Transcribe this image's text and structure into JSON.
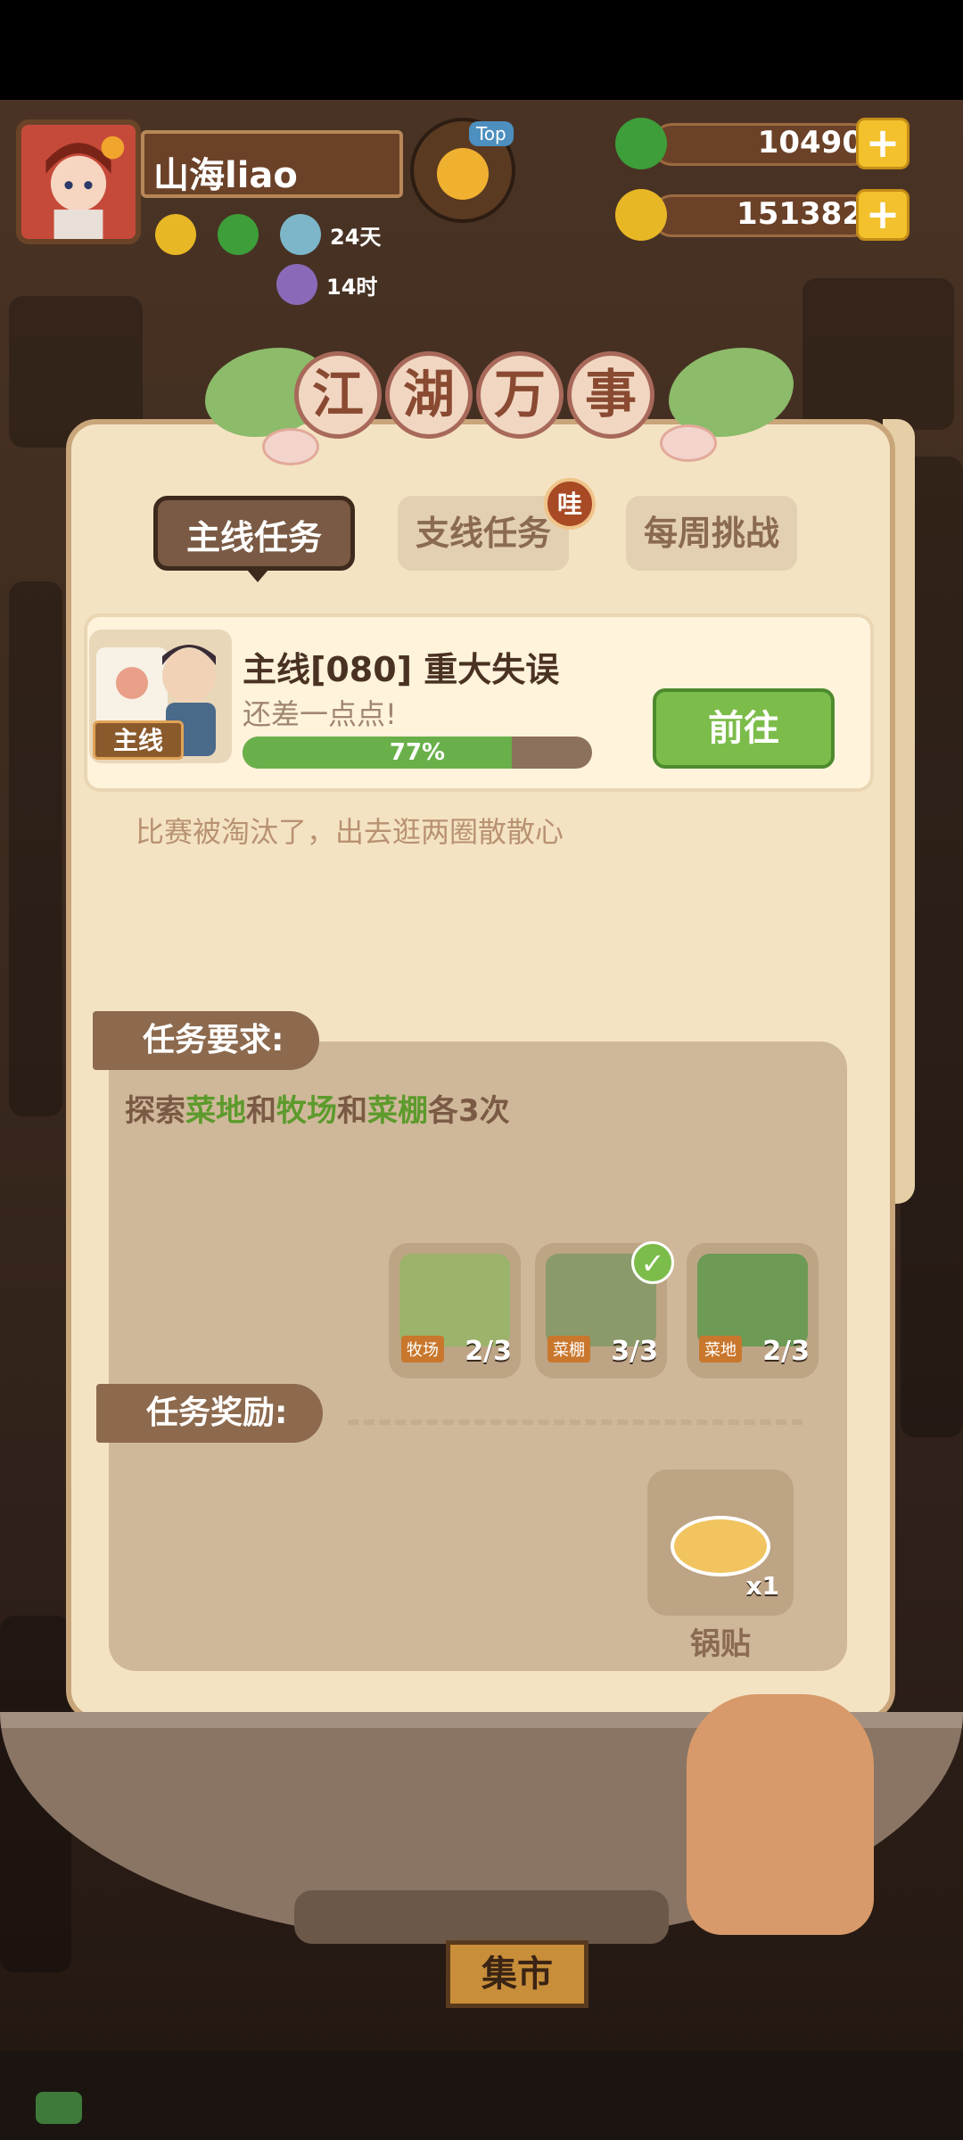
{
  "player": {
    "name": "山海liao"
  },
  "buffs": [
    {
      "icon": "gold-coin-buff-icon"
    },
    {
      "icon": "jade-buff-icon"
    },
    {
      "icon": "dish-buff-icon",
      "time": "24天"
    },
    {
      "icon": "girl-buff-icon",
      "time": "14时"
    }
  ],
  "top_button": {
    "label": "Top"
  },
  "resources": [
    {
      "icon": "jade-coin-icon",
      "value": "10490",
      "plus": "+",
      "color": "#3d9e3a"
    },
    {
      "icon": "gold-coin-icon",
      "value": "151382",
      "plus": "+",
      "color": "#e8b726"
    }
  ],
  "dialog": {
    "title_chars": [
      "江",
      "湖",
      "万",
      "事"
    ],
    "tabs": [
      {
        "label": "主线任务",
        "active": true
      },
      {
        "label": "支线任务",
        "active": false,
        "badge": "哇"
      },
      {
        "label": "每周挑战",
        "active": false
      }
    ],
    "quest": {
      "tag": "主线",
      "title": "主线[080] 重大失误",
      "subtitle": "还差一点点!",
      "progress": 77,
      "progress_text": "77%",
      "go_button": "前往",
      "description": "比赛被淘汰了，出去逛两圈散散心"
    },
    "requirements": {
      "heading": "任务要求:",
      "text_parts": [
        "探索",
        "菜地",
        "和",
        "牧场",
        "和",
        "菜棚",
        "各3次"
      ],
      "locations": [
        {
          "tag": "牧场",
          "count": "2/3",
          "done": false,
          "color": "#9bb36a"
        },
        {
          "tag": "菜棚",
          "count": "3/3",
          "done": true,
          "color": "#8a9a6a"
        },
        {
          "tag": "菜地",
          "count": "2/3",
          "done": false,
          "color": "#6d9a55"
        }
      ],
      "check": "✓"
    },
    "rewards": {
      "heading": "任务奖励:",
      "items": [
        {
          "name": "锅贴",
          "qty": "x1"
        }
      ]
    }
  },
  "bottom": {
    "market_label": "集市"
  }
}
